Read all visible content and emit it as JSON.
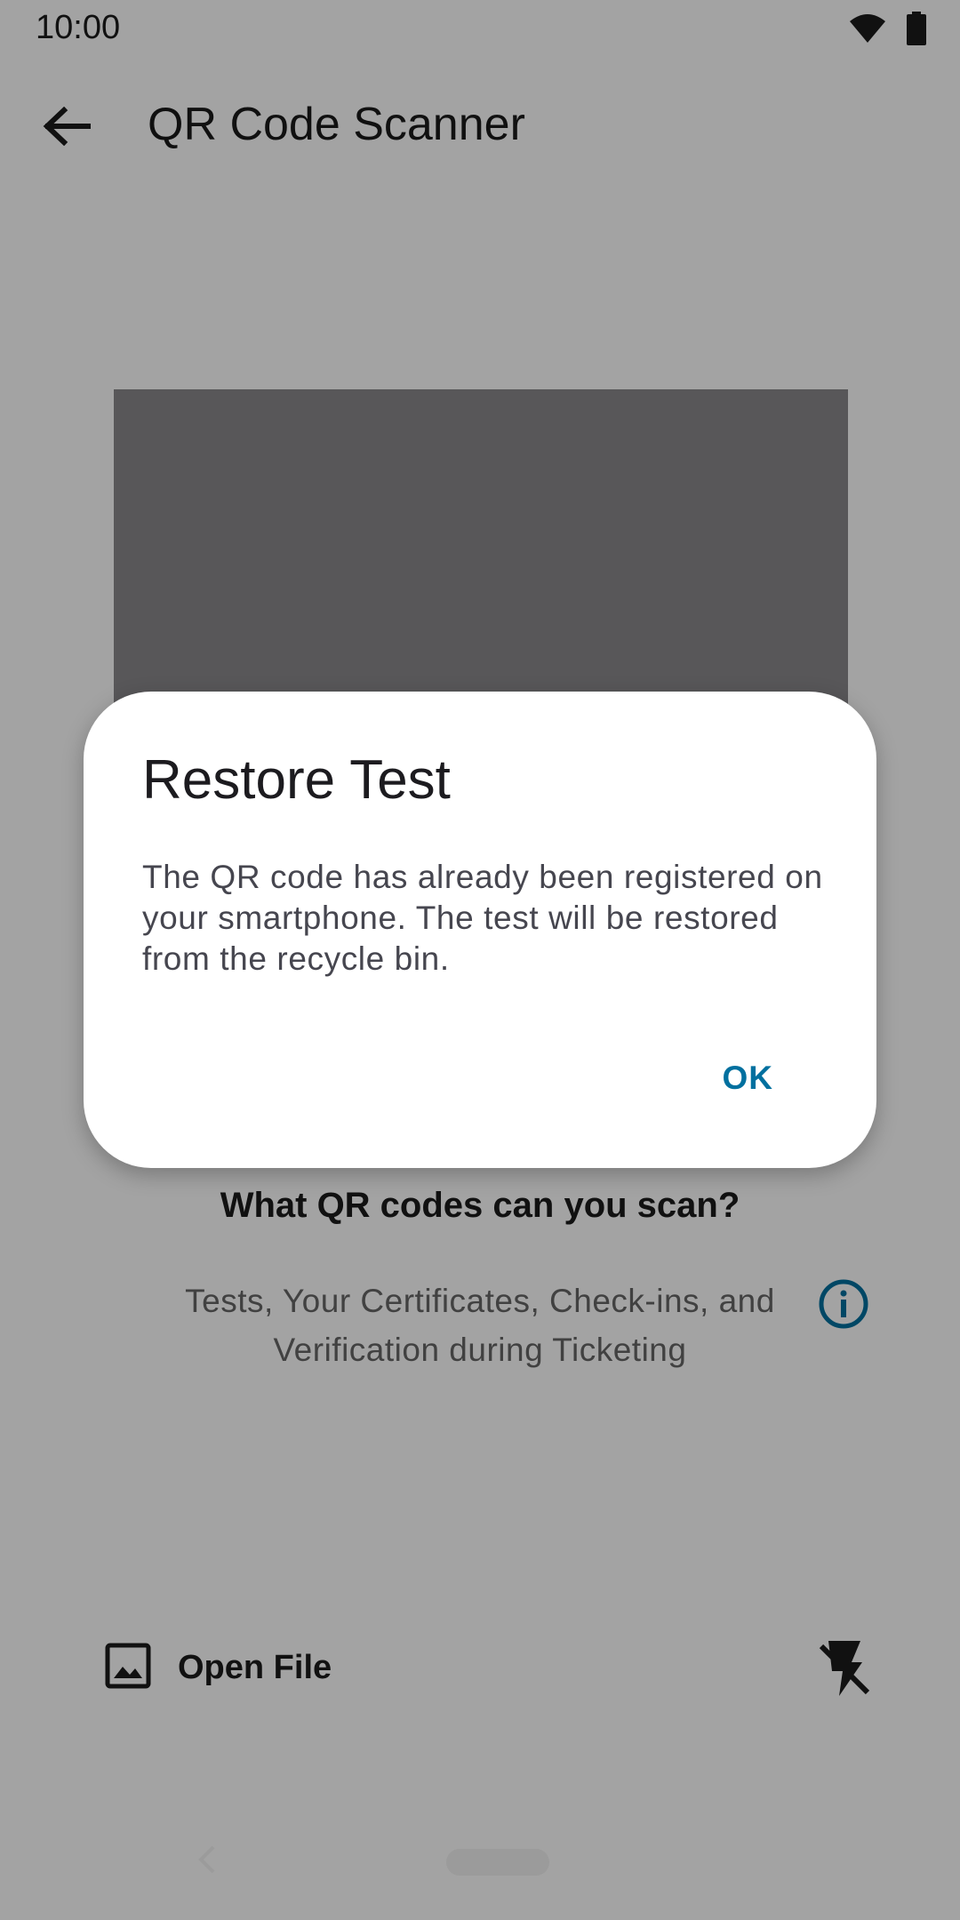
{
  "status_bar": {
    "time": "10:00",
    "icons": [
      "wifi-icon",
      "battery-icon"
    ]
  },
  "app_bar": {
    "title": "QR Code Scanner",
    "back_icon": "arrow-back-icon"
  },
  "info": {
    "heading": "What QR codes can you scan?",
    "text": "Tests, Your Certificates, Check-ins, and Verification during Ticketing",
    "icon": "info-icon"
  },
  "actions": {
    "open_file_label": "Open File",
    "open_file_icon": "image-icon",
    "flash_icon": "flash-off-icon"
  },
  "dialog": {
    "title": "Restore Test",
    "message": "The QR code has already been registered on your smartphone. The test will be restored from the recycle bin.",
    "ok_label": "OK"
  },
  "colors": {
    "accent": "#00709f",
    "scrim": "rgba(0,0,0,0.36)"
  }
}
